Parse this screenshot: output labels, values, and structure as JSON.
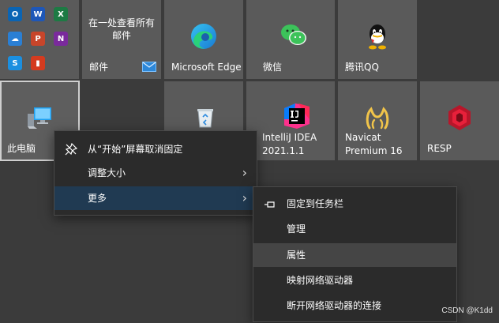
{
  "tiles": {
    "mail_header_line1": "在一处查看所有",
    "mail_header_line2": "邮件",
    "mail": "邮件",
    "edge": "Microsoft Edge",
    "wechat": "微信",
    "qq": "腾讯QQ",
    "this_pc": "此电脑",
    "intellij_line1": "IntelliJ IDEA",
    "intellij_line2": "2021.1.1",
    "navicat_line1": "Navicat",
    "navicat_line2": "Premium 16",
    "resp": "RESP"
  },
  "office_apps": [
    {
      "icon": "outlook-icon",
      "letter": "O",
      "color": "#0a64b4"
    },
    {
      "icon": "word-icon",
      "letter": "W",
      "color": "#1e57b8"
    },
    {
      "icon": "excel-icon",
      "letter": "X",
      "color": "#1d7a44"
    },
    {
      "icon": "onedrive-icon",
      "letter": "☁",
      "color": "#2a7fd4"
    },
    {
      "icon": "powerpoint-icon",
      "letter": "P",
      "color": "#c8452a"
    },
    {
      "icon": "onenote-icon",
      "letter": "N",
      "color": "#7a2a9c"
    },
    {
      "icon": "skype-icon",
      "letter": "S",
      "color": "#1b8fe0"
    },
    {
      "icon": "office-icon",
      "letter": "▮",
      "color": "#d43b1f"
    }
  ],
  "context_menu": {
    "items": [
      {
        "label": "从“开始”屏幕取消固定",
        "icon": "unpin-icon"
      },
      {
        "label": "调整大小",
        "chevron": "›"
      },
      {
        "label": "更多",
        "chevron": "›"
      }
    ]
  },
  "submenu": {
    "items": [
      {
        "label": "固定到任务栏",
        "icon": "pin-taskbar-icon"
      },
      {
        "label": "管理"
      },
      {
        "label": "属性"
      },
      {
        "label": "映射网络驱动器"
      },
      {
        "label": "断开网络驱动器的连接"
      }
    ]
  },
  "watermark": "CSDN @K1dd",
  "colors": {
    "tile": "#5a5a5a",
    "background": "#3b3b3b",
    "menu": "#2b2b2b",
    "active_item": "#203a52"
  }
}
